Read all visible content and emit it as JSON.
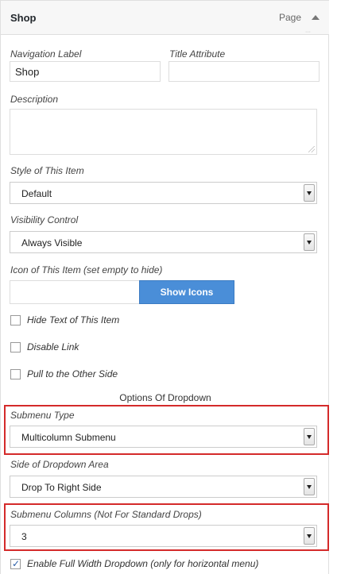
{
  "header": {
    "title": "Shop",
    "type_label": "Page",
    "scroll_hint": "···"
  },
  "fields": {
    "navigation_label": {
      "label": "Navigation Label",
      "value": "Shop"
    },
    "title_attribute": {
      "label": "Title Attribute",
      "value": ""
    },
    "description": {
      "label": "Description",
      "value": ""
    },
    "style": {
      "label": "Style of This Item",
      "selected": "Default"
    },
    "visibility": {
      "label": "Visibility Control",
      "selected": "Always Visible"
    },
    "icon": {
      "label": "Icon of This Item (set empty to hide)",
      "value": "",
      "button_label": "Show Icons"
    }
  },
  "checkboxes": {
    "hide_text": {
      "label": "Hide Text of This Item",
      "checked": false
    },
    "disable_link": {
      "label": "Disable Link",
      "checked": false
    },
    "pull_other_side": {
      "label": "Pull to the Other Side",
      "checked": false
    },
    "full_width": {
      "label": "Enable Full Width Dropdown (only for horizontal menu)",
      "checked": true
    }
  },
  "dropdown_options": {
    "title": "Options Of Dropdown",
    "submenu_type": {
      "label": "Submenu Type",
      "selected": "Multicolumn Submenu"
    },
    "side_of_dropdown": {
      "label": "Side of Dropdown Area",
      "selected": "Drop To Right Side"
    },
    "submenu_columns": {
      "label": "Submenu Columns (Not For Standard Drops)",
      "selected": "3"
    }
  },
  "colors": {
    "highlight": "#d42a2a",
    "primary_button": "#4a8ed8"
  }
}
